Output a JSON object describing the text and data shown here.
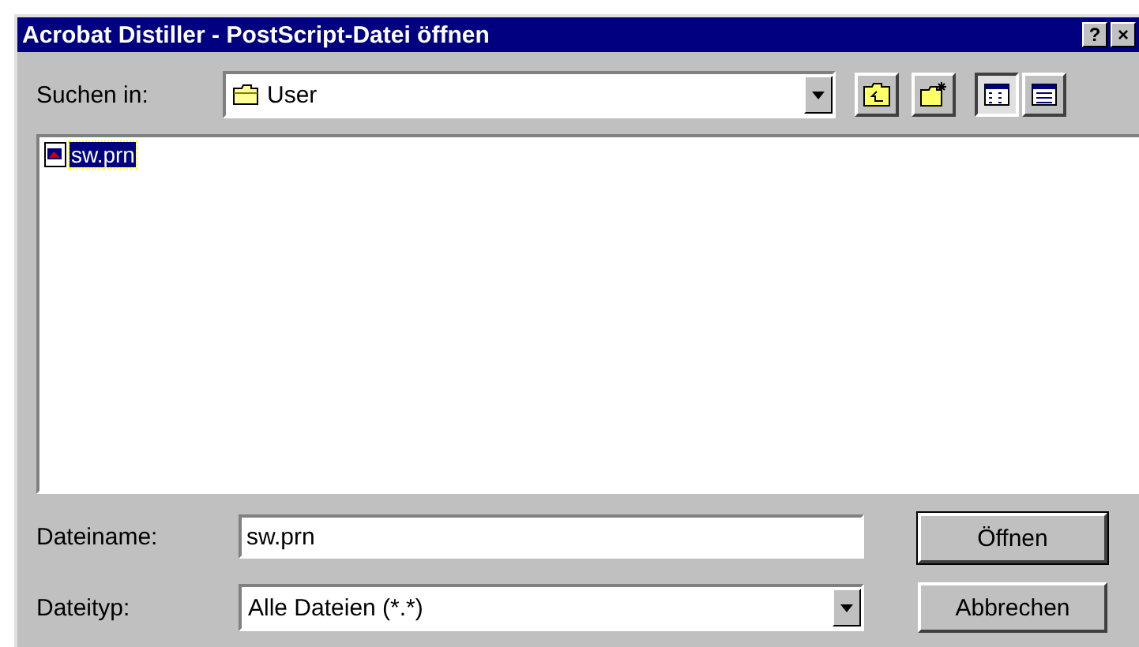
{
  "window": {
    "title": "Acrobat Distiller - PostScript-Datei öffnen",
    "title_buttons": [
      "?",
      "×"
    ]
  },
  "look_in": {
    "label": "Suchen in:",
    "value": "User"
  },
  "toolbar": [
    {
      "kind": "up"
    },
    {
      "kind": "new-folder"
    },
    {
      "kind": "list",
      "selected": true
    },
    {
      "kind": "details",
      "selected": false
    }
  ],
  "files": [
    {
      "name": "sw.prn",
      "selected": true
    }
  ],
  "filename": {
    "label": "Dateiname:",
    "value": "sw.prn"
  },
  "filetype": {
    "label": "Dateityp:",
    "value": "Alle Dateien (*.*)"
  },
  "buttons": [
    {
      "label": "Öffnen",
      "default": true
    },
    {
      "label": "Abbrechen",
      "default": false
    }
  ]
}
